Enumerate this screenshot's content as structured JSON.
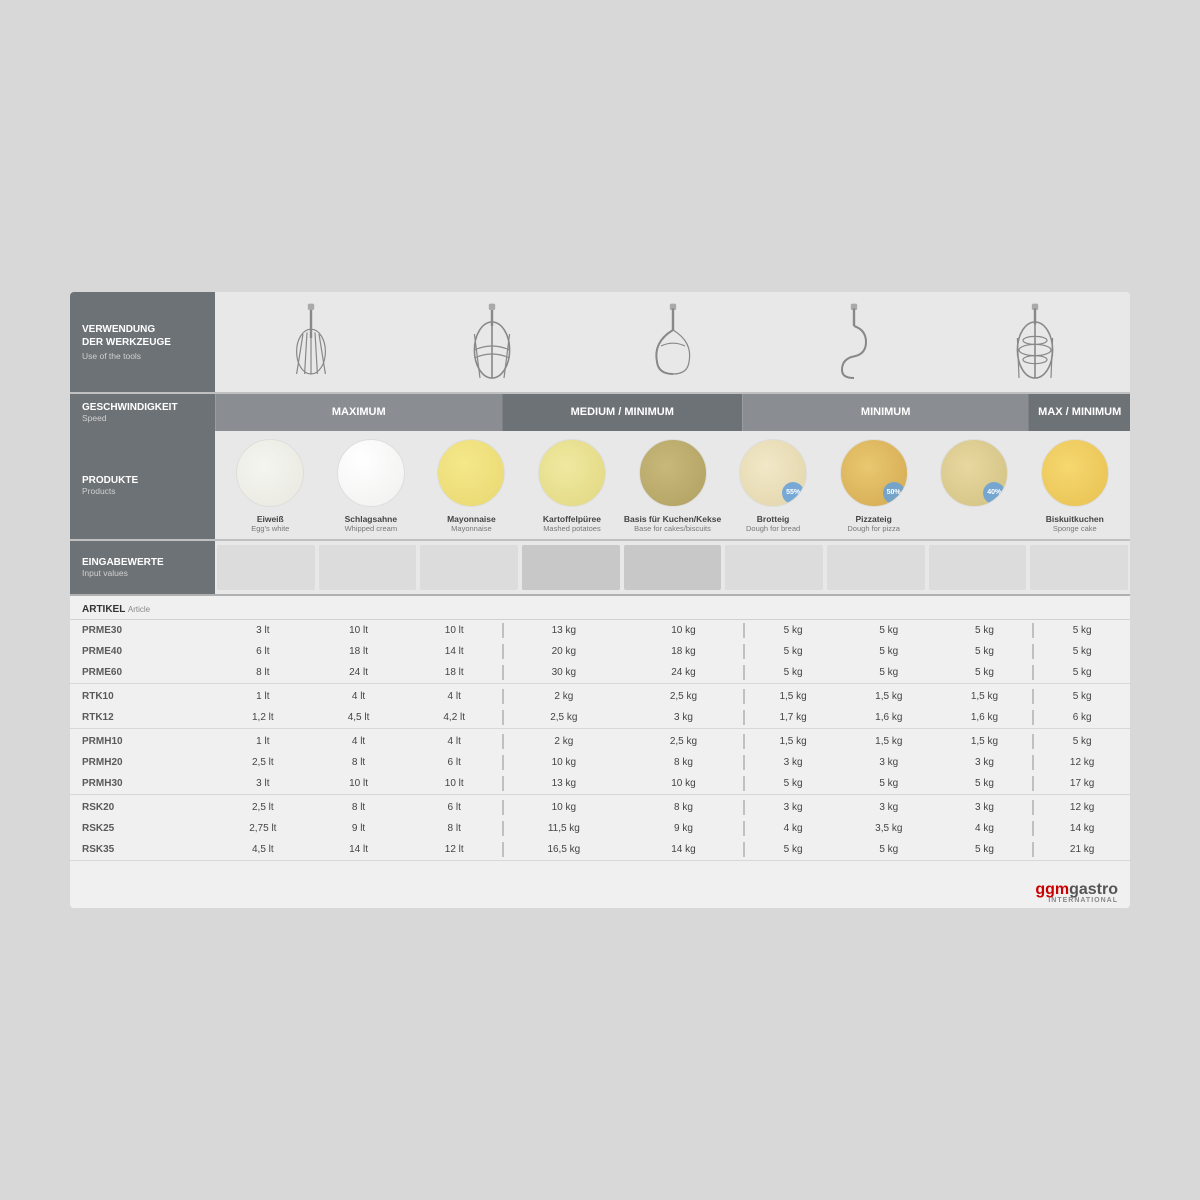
{
  "header": {
    "verwendung_label": "VERWENDUNG\nDER WERKZEUGE",
    "verwendung_sub": "Use of the tools",
    "geschwindigkeit_label": "GESCHWINDIGKEIT",
    "geschwindigkeit_sub": "Speed",
    "produkte_label": "PRODUKTE",
    "produkte_sub": "Products",
    "eingabewerte_label": "EINGABEWERTE",
    "eingabewerte_sub": "Input values",
    "artikel_label": "ARTIKEL",
    "artikel_sub": "Article"
  },
  "speed_bands": {
    "maximum": "MAXIMUM",
    "medium": "MEDIUM / MINIMUM",
    "minimum": "MINIMUM",
    "maxmin": "MAX / MINIMUM"
  },
  "products": [
    {
      "name": "Eiweiß",
      "sub": "Egg's white",
      "type": "egg-white",
      "percent": ""
    },
    {
      "name": "Schlagsahne",
      "sub": "Whipped cream",
      "type": "whipped",
      "percent": ""
    },
    {
      "name": "Mayonnaise",
      "sub": "Mayonnaise",
      "type": "mayo",
      "percent": ""
    },
    {
      "name": "Kartoffelpüree",
      "sub": "Mashed potatoes",
      "type": "mashed",
      "percent": ""
    },
    {
      "name": "Basis für Kuchen/Kekse",
      "sub": "Base for cakes/biscuits",
      "type": "cake-base",
      "percent": ""
    },
    {
      "name": "Brotteig",
      "sub": "Dough for bread",
      "type": "bread",
      "percent": "55%"
    },
    {
      "name": "Pizzateig",
      "sub": "Dough for pizza",
      "type": "pizza",
      "percent": "50%"
    },
    {
      "name": "",
      "sub": "",
      "type": "pizza2",
      "percent": "40%"
    },
    {
      "name": "Biskuitkuchen",
      "sub": "Sponge cake",
      "type": "sponge",
      "percent": ""
    }
  ],
  "table_groups": [
    {
      "rows": [
        {
          "label": "PRME30",
          "cols": [
            "3 lt",
            "10 lt",
            "10 lt",
            "13 kg",
            "10 kg",
            "5 kg",
            "5 kg",
            "5 kg",
            "5 kg"
          ]
        },
        {
          "label": "PRME40",
          "cols": [
            "6 lt",
            "18 lt",
            "14 lt",
            "20 kg",
            "18 kg",
            "5 kg",
            "5 kg",
            "5 kg",
            "5 kg"
          ]
        },
        {
          "label": "PRME60",
          "cols": [
            "8 lt",
            "24 lt",
            "18 lt",
            "30 kg",
            "24 kg",
            "5 kg",
            "5 kg",
            "5 kg",
            "5 kg"
          ]
        }
      ]
    },
    {
      "rows": [
        {
          "label": "RTK10",
          "cols": [
            "1 lt",
            "4 lt",
            "4 lt",
            "2 kg",
            "2,5 kg",
            "1,5 kg",
            "1,5 kg",
            "1,5 kg",
            "5 kg"
          ]
        },
        {
          "label": "RTK12",
          "cols": [
            "1,2 lt",
            "4,5 lt",
            "4,2 lt",
            "2,5 kg",
            "3 kg",
            "1,7 kg",
            "1,6 kg",
            "1,6 kg",
            "6 kg"
          ]
        }
      ]
    },
    {
      "rows": [
        {
          "label": "PRMH10",
          "cols": [
            "1 lt",
            "4 lt",
            "4 lt",
            "2 kg",
            "2,5 kg",
            "1,5 kg",
            "1,5 kg",
            "1,5 kg",
            "5 kg"
          ]
        },
        {
          "label": "PRMH20",
          "cols": [
            "2,5 lt",
            "8 lt",
            "6 lt",
            "10 kg",
            "8 kg",
            "3 kg",
            "3 kg",
            "3 kg",
            "12 kg"
          ]
        },
        {
          "label": "PRMH30",
          "cols": [
            "3 lt",
            "10 lt",
            "10 lt",
            "13 kg",
            "10 kg",
            "5 kg",
            "5 kg",
            "5 kg",
            "17 kg"
          ]
        }
      ]
    },
    {
      "rows": [
        {
          "label": "RSK20",
          "cols": [
            "2,5 lt",
            "8 lt",
            "6 lt",
            "10 kg",
            "8 kg",
            "3 kg",
            "3 kg",
            "3 kg",
            "12 kg"
          ]
        },
        {
          "label": "RSK25",
          "cols": [
            "2,75 lt",
            "9 lt",
            "8 lt",
            "11,5 kg",
            "9 kg",
            "4 kg",
            "3,5 kg",
            "4 kg",
            "14 kg"
          ]
        },
        {
          "label": "RSK35",
          "cols": [
            "4,5 lt",
            "14 lt",
            "12 lt",
            "16,5 kg",
            "14 kg",
            "5 kg",
            "5 kg",
            "5 kg",
            "21 kg"
          ]
        }
      ]
    }
  ],
  "branding": {
    "ggm": "ggm",
    "gastro": "gastro",
    "international": "INTERNATIONAL"
  }
}
